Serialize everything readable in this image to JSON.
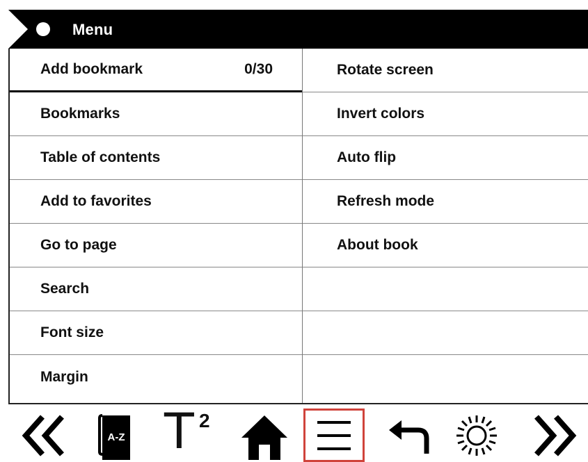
{
  "header": {
    "title": "Menu"
  },
  "left_menu": {
    "items": [
      {
        "label": "Add bookmark",
        "count": "0/30"
      },
      {
        "label": "Bookmarks"
      },
      {
        "label": "Table of contents"
      },
      {
        "label": "Add to favorites"
      },
      {
        "label": "Go to page"
      },
      {
        "label": "Search"
      },
      {
        "label": "Font size"
      },
      {
        "label": "Margin"
      }
    ]
  },
  "right_menu": {
    "items": [
      {
        "label": "Rotate screen"
      },
      {
        "label": "Invert colors"
      },
      {
        "label": "Auto flip"
      },
      {
        "label": "Refresh mode"
      },
      {
        "label": "About book"
      }
    ]
  },
  "toolbar": {
    "buttons": [
      {
        "icon": "double-chevron-left-icon"
      },
      {
        "icon": "dictionary-icon",
        "label": "A-Z"
      },
      {
        "icon": "font-size-icon",
        "label": "T",
        "superscript": "2"
      },
      {
        "icon": "home-icon"
      },
      {
        "icon": "menu-icon",
        "selected": true
      },
      {
        "icon": "back-arrow-icon"
      },
      {
        "icon": "brightness-icon"
      },
      {
        "icon": "double-chevron-right-icon"
      }
    ],
    "highlight_color": "#d0433b"
  }
}
